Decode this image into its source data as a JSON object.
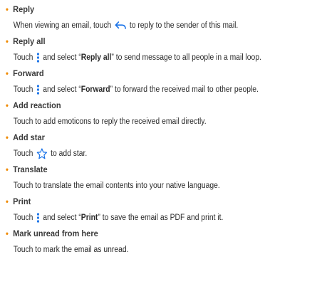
{
  "items": [
    {
      "title": "Reply",
      "pre": "When viewing an email, touch ",
      "icon": "reply-arrow-icon",
      "post": " to reply to the sender of this mail."
    },
    {
      "title": "Reply all",
      "pre": "Touch ",
      "icon": "more-vertical-icon",
      "mid1": " and select “",
      "bold": "Reply all",
      "post": "” to send message to all people in a mail loop."
    },
    {
      "title": "Forward",
      "pre": "Touch ",
      "icon": "more-vertical-icon",
      "mid1": " and select “",
      "bold": "Forward",
      "post": "” to forward the received mail to other people."
    },
    {
      "title": "Add reaction",
      "text": "Touch to add emoticons to reply the received email directly."
    },
    {
      "title": "Add star",
      "pre": "Touch ",
      "icon": "star-outline-icon",
      "post": " to add star."
    },
    {
      "title": "Translate",
      "text": "Touch to translate the email contents into your native language."
    },
    {
      "title": "Print",
      "pre": "Touch ",
      "icon": "more-vertical-icon",
      "mid1": " and select “",
      "bold": "Print",
      "post": "” to save the email as PDF and print it."
    },
    {
      "title": "Mark unread from here",
      "text": "Touch to mark the email as unread."
    }
  ],
  "colors": {
    "bullet": "#f08a00",
    "icon": "#1a73e8"
  },
  "bullet_char": "•"
}
